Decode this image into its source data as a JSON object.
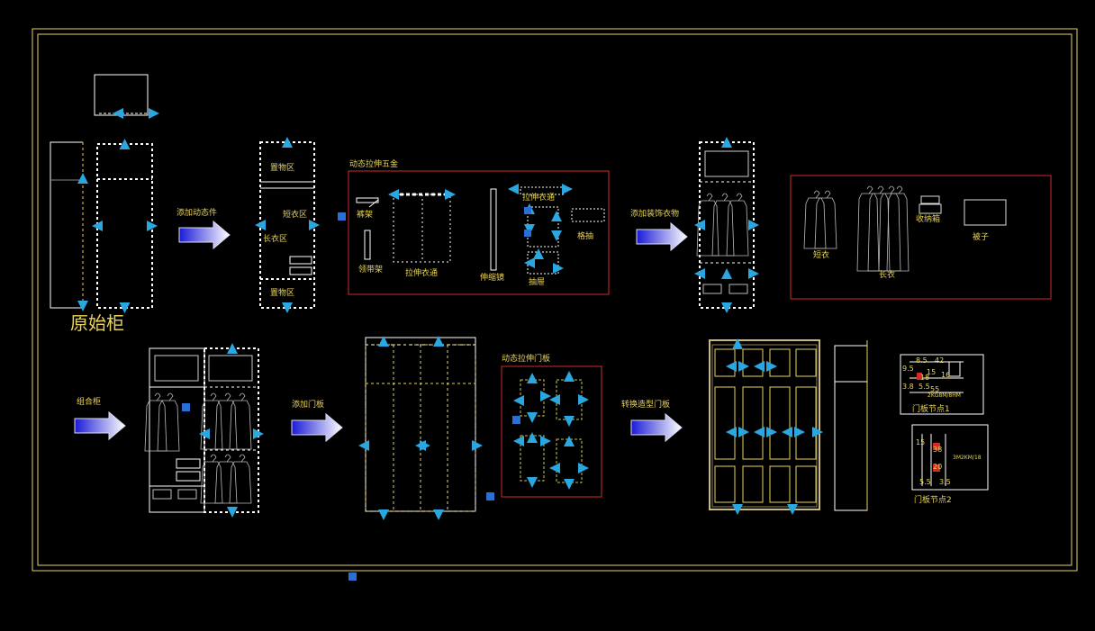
{
  "colors": {
    "background": "#000000",
    "frame": "#e8d45a",
    "outline": "#ffffff",
    "grip": "#2aa7e0",
    "red_box": "#d42a2a",
    "arrow_fill": "#4b4bf0",
    "dim": "#c9c24a"
  },
  "stage1": {
    "title": "原始柜",
    "arrow_label": "添加动态件"
  },
  "stage2": {
    "zone_top": "置物区",
    "zone_short": "短衣区",
    "zone_long": "长衣区",
    "zone_bottom": "置物区"
  },
  "hardware_panel": {
    "title": "动态拉伸五金",
    "pants_rack": "裤架",
    "tie_rack": "领带架",
    "rod": "拉伸衣通",
    "mirror": "伸缩镜",
    "rod_top": "拉伸衣通",
    "drawer": "抽屉",
    "grid_drawer": "格抽"
  },
  "stage3": {
    "arrow_label": "添加装饰衣物"
  },
  "clothes_panel": {
    "short_coat": "短衣",
    "long_coat": "长衣",
    "storage_box": "收纳箱",
    "quilt": "被子"
  },
  "row2": {
    "combo_label": "组合柜",
    "door_label": "添加门板",
    "door_panel_title": "动态拉伸门板",
    "swap_label": "转换造型门板",
    "node1": "门板节点1",
    "node2": "门板节点2"
  },
  "node1_dims": [
    "8.5",
    "42",
    "9.5",
    "15",
    "16",
    "3.8",
    "55",
    "18",
    "5.5"
  ],
  "node1_note": "2KG8M/8HM",
  "node2_dims": [
    "15",
    "38",
    "20",
    "5.5",
    "3.5"
  ],
  "node2_note": "3M2KM/18"
}
